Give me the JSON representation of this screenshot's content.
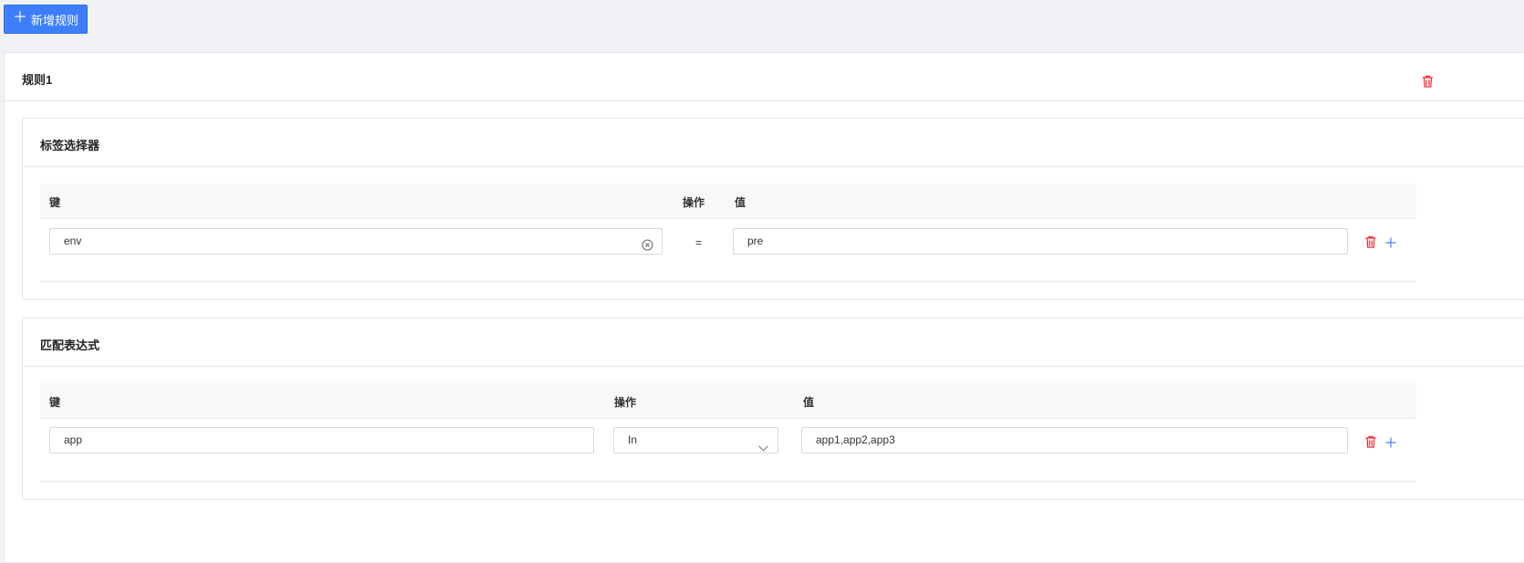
{
  "toolbar": {
    "add_rule_label": "新增规则",
    "add_icon": "plus-icon"
  },
  "rule": {
    "title": "规则1",
    "delete_icon": "trash-icon",
    "label_selector": {
      "title": "标签选择器",
      "headers": {
        "key": "键",
        "op": "操作",
        "value": "值"
      },
      "rows": [
        {
          "key": "env",
          "op": "=",
          "value": "pre"
        }
      ]
    },
    "match_expressions": {
      "title": "匹配表达式",
      "headers": {
        "key": "键",
        "op": "操作",
        "value": "值"
      },
      "rows": [
        {
          "key": "app",
          "op": "In",
          "value": "app1,app2,app3"
        }
      ]
    }
  },
  "colors": {
    "primary": "#3d7ffb",
    "danger": "#f5222d",
    "add_icon": "#3d7ffb"
  }
}
